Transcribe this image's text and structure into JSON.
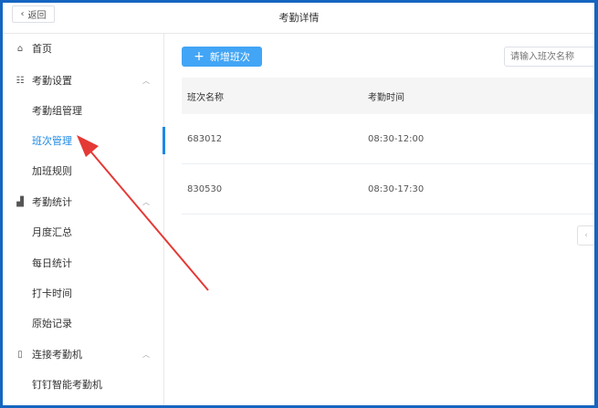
{
  "header": {
    "back_label": "返回",
    "title": "考勤详情"
  },
  "sidebar": {
    "items": [
      {
        "label": "首页",
        "icon": "home-icon"
      },
      {
        "label": "考勤设置",
        "icon": "settings-icon",
        "expanded": true
      },
      {
        "label": "考勤组管理"
      },
      {
        "label": "班次管理",
        "active": true
      },
      {
        "label": "加班规则"
      },
      {
        "label": "考勤统计",
        "icon": "bar-chart-icon",
        "expanded": true
      },
      {
        "label": "月度汇总"
      },
      {
        "label": "每日统计"
      },
      {
        "label": "打卡时间"
      },
      {
        "label": "原始记录"
      },
      {
        "label": "连接考勤机",
        "icon": "device-icon",
        "expanded": true
      },
      {
        "label": "钉钉智能考勤机"
      }
    ]
  },
  "main": {
    "add_button": "新增班次",
    "search_placeholder": "请输入班次名称",
    "columns": [
      "班次名称",
      "考勤时间"
    ],
    "rows": [
      [
        "683012",
        "08:30-12:00"
      ],
      [
        "830530",
        "08:30-17:30"
      ]
    ]
  },
  "colors": {
    "accent": "#1e88e5",
    "button": "#42a5f5",
    "annotation_arrow": "#e53935"
  }
}
